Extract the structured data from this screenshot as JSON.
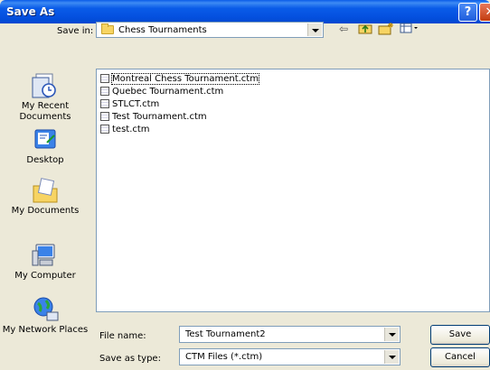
{
  "window": {
    "title": "Save As"
  },
  "toolbar": {
    "save_in_label": "Save in:",
    "save_in_value": "Chess Tournaments",
    "back_icon": "back-arrow-icon",
    "up_icon": "up-folder-icon",
    "new_folder_icon": "new-folder-icon",
    "views_icon": "views-menu-icon"
  },
  "places": [
    {
      "label": "My Recent Documents",
      "icon": "recent-documents-icon"
    },
    {
      "label": "Desktop",
      "icon": "desktop-icon"
    },
    {
      "label": "My Documents",
      "icon": "my-documents-icon"
    },
    {
      "label": "My Computer",
      "icon": "my-computer-icon"
    },
    {
      "label": "My Network Places",
      "icon": "network-places-icon"
    }
  ],
  "files": [
    {
      "name": "Montreal Chess Tournament.ctm",
      "selected": true
    },
    {
      "name": "Quebec Tournament.ctm",
      "selected": false
    },
    {
      "name": "STLCT.ctm",
      "selected": false
    },
    {
      "name": "Test Tournament.ctm",
      "selected": false
    },
    {
      "name": "test.ctm",
      "selected": false
    }
  ],
  "form": {
    "file_name_label": "File name:",
    "file_name_value": "Test Tournament2",
    "save_type_label": "Save as type:",
    "save_type_value": "CTM Files (*.ctm)"
  },
  "buttons": {
    "save": "Save",
    "cancel": "Cancel"
  }
}
